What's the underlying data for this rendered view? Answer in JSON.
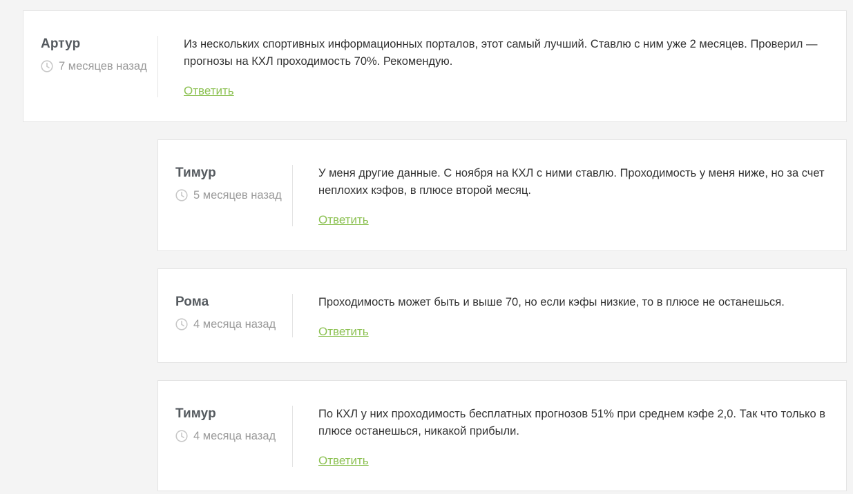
{
  "colors": {
    "accent": "#8cc152",
    "background": "#f4f4f4",
    "card": "#ffffff",
    "border": "#e4e4e4",
    "author": "#555a5f",
    "muted": "#9a9a9a"
  },
  "icons": {
    "date": "clock-icon"
  },
  "comments": [
    {
      "author": "Артур",
      "date": "7 месяцев назад",
      "text": "Из нескольких спортивных информационных порталов, этот самый лучший. Ставлю с ним уже 2 месяцев. Проверил — прогнозы на КХЛ проходимость 70%. Рекомендую.",
      "reply_label": "Ответить"
    },
    {
      "author": "Тимур",
      "date": "5 месяцев назад",
      "text": "У меня другие данные. С ноября на КХЛ с ними ставлю. Проходимость у меня ниже, но за счет неплохих кэфов, в плюсе второй месяц.",
      "reply_label": "Ответить"
    },
    {
      "author": "Рома",
      "date": "4 месяца назад",
      "text": "Проходимость может быть и выше 70, но если кэфы низкие, то в плюсе не останешься.",
      "reply_label": "Ответить"
    },
    {
      "author": "Тимур",
      "date": "4 месяца назад",
      "text": "По КХЛ у них проходимость бесплатных прогнозов 51% при среднем кэфе 2,0. Так что только в плюсе останешься, никакой прибыли.",
      "reply_label": "Ответить"
    }
  ]
}
